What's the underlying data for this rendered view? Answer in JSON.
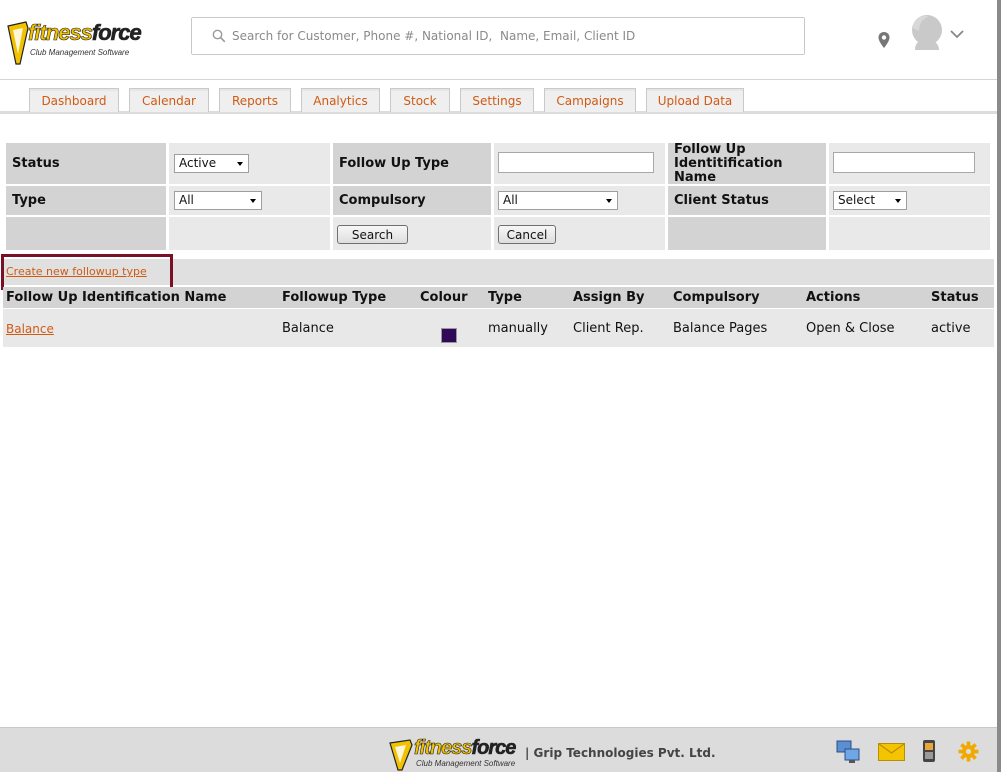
{
  "brand": {
    "name_part1": "fitness",
    "name_part2": "force",
    "tagline": "Club Management Software",
    "color_yellow": "#f2c200"
  },
  "header": {
    "search_placeholder": "Search for Customer, Phone #, National ID,  Name, Email, Client ID"
  },
  "tabs": [
    "Dashboard",
    "Calendar",
    "Reports",
    "Analytics",
    "Stock",
    "Settings",
    "Campaigns",
    "Upload Data"
  ],
  "filters": {
    "status_label": "Status",
    "status_value": "Active",
    "followup_type_label": "Follow Up Type",
    "followup_type_value": "",
    "followup_id_label": "Follow Up Identitification Name",
    "followup_id_value": "",
    "type_label": "Type",
    "type_value": "All",
    "compulsory_label": "Compulsory",
    "compulsory_value": "All",
    "client_status_label": "Client Status",
    "client_status_value": "Select",
    "search_button": "Search",
    "cancel_button": "Cancel"
  },
  "create_link": "Create new followup type",
  "table": {
    "columns": [
      "Follow Up Identification Name",
      "Followup Type",
      "Colour",
      "Type",
      "Assign By",
      "Compulsory",
      "Actions",
      "Status"
    ],
    "rows": [
      {
        "name": "Balance",
        "followup_type": "Balance",
        "colour": "#2e0a59",
        "type": "manually",
        "assign_by": "Client Rep.",
        "compulsory": "Balance Pages",
        "actions": "Open & Close",
        "status": "active"
      }
    ]
  },
  "footer": {
    "company": "| Grip Technologies Pvt. Ltd."
  },
  "colors": {
    "accent_orange": "#cf5a13",
    "highlight_box": "#7a1023"
  }
}
